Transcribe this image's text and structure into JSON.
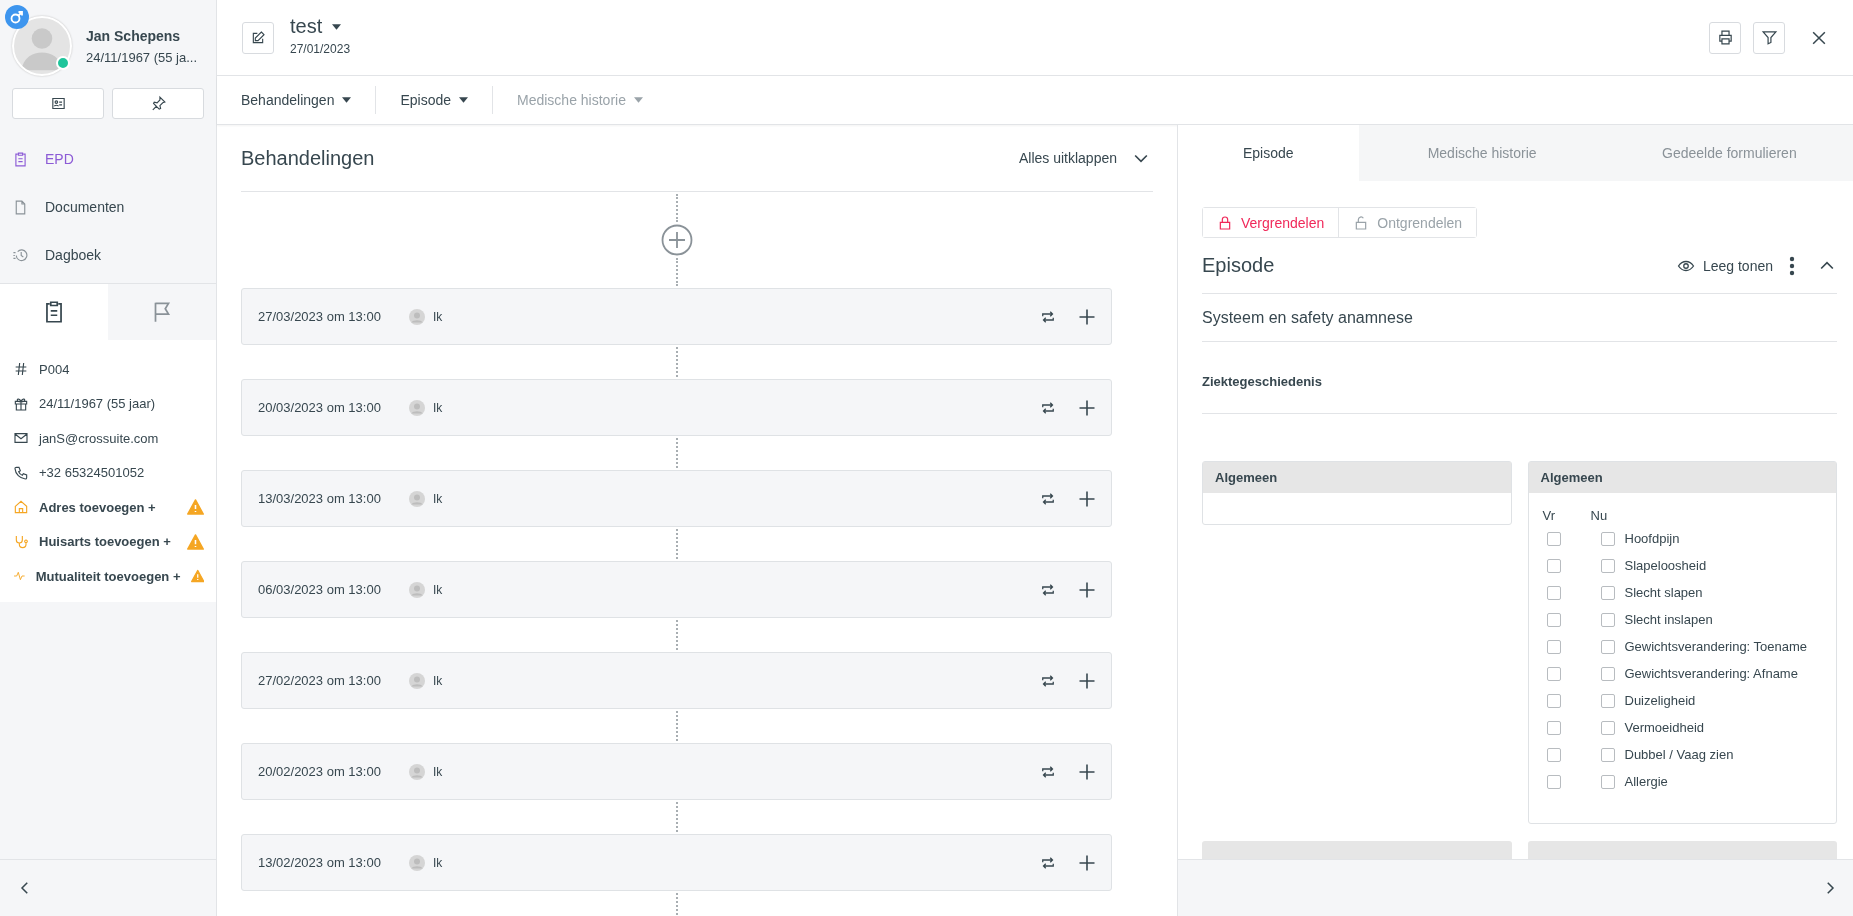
{
  "patient": {
    "name": "Jan Schepens",
    "birth": "24/11/1967 (55 ja...",
    "online": true
  },
  "sidebar_nav": [
    {
      "label": "EPD",
      "selected": true
    },
    {
      "label": "Documenten",
      "selected": false
    },
    {
      "label": "Dagboek",
      "selected": false
    }
  ],
  "sidebar_tabs": [
    {
      "selected": true
    },
    {
      "selected": false
    }
  ],
  "details": [
    {
      "kind": "info",
      "text": "P004"
    },
    {
      "kind": "info",
      "text": "24/11/1967 (55 jaar)"
    },
    {
      "kind": "info",
      "text": "janS@crossuite.com"
    },
    {
      "kind": "info",
      "text": "+32 65324501052"
    },
    {
      "kind": "warning",
      "text": "Adres toevoegen +"
    },
    {
      "kind": "warning",
      "text": "Huisarts toevoegen +"
    },
    {
      "kind": "warning",
      "text": "Mutualiteit toevoegen +"
    }
  ],
  "header": {
    "title": "test",
    "date": "27/01/2023"
  },
  "subnav": [
    {
      "label": "Behandelingen",
      "disabled": false
    },
    {
      "label": "Episode",
      "disabled": false
    },
    {
      "label": "Medische historie",
      "disabled": true
    }
  ],
  "treatments": {
    "title": "Behandelingen",
    "expand_label": "Alles uitklappen",
    "items": [
      {
        "date": "27/03/2023 om 13:00",
        "user": "Ik"
      },
      {
        "date": "20/03/2023 om 13:00",
        "user": "Ik"
      },
      {
        "date": "13/03/2023 om 13:00",
        "user": "Ik"
      },
      {
        "date": "06/03/2023 om 13:00",
        "user": "Ik"
      },
      {
        "date": "27/02/2023 om 13:00",
        "user": "Ik"
      },
      {
        "date": "20/02/2023 om 13:00",
        "user": "Ik"
      },
      {
        "date": "13/02/2023 om 13:00",
        "user": "Ik"
      }
    ]
  },
  "right": {
    "tabs": [
      {
        "label": "Episode",
        "selected": true
      },
      {
        "label": "Medische historie",
        "selected": false
      },
      {
        "label": "Gedeelde formulieren",
        "selected": false
      }
    ],
    "lock_buttons": [
      {
        "label": "Vergrendelen",
        "selected": true
      },
      {
        "label": "Ontgrendelen",
        "selected": false
      }
    ],
    "section_title": "Episode",
    "show_empty": "Leeg tonen",
    "subsection": "Systeem en safety anamnese",
    "field_label": "Ziektegeschiedenis",
    "panels": [
      {
        "title": "Algemeen"
      },
      {
        "title": "Algemeen",
        "columns": [
          "Vr",
          "Nu"
        ],
        "items": [
          {
            "label": "Hoofdpijn",
            "vr": false,
            "nu": false
          },
          {
            "label": "Slapeloosheid",
            "vr": false,
            "nu": false
          },
          {
            "label": "Slecht slapen",
            "vr": false,
            "nu": false
          },
          {
            "label": "Slecht inslapen",
            "vr": false,
            "nu": false
          },
          {
            "label": "Gewichtsverandering: Toename",
            "vr": false,
            "nu": false
          },
          {
            "label": "Gewichtsverandering: Afname",
            "vr": false,
            "nu": false
          },
          {
            "label": "Duizeligheid",
            "vr": false,
            "nu": false
          },
          {
            "label": "Vermoeidheid",
            "vr": false,
            "nu": false
          },
          {
            "label": "Dubbel / Vaag zien",
            "vr": false,
            "nu": false
          },
          {
            "label": "Allergie",
            "vr": false,
            "nu": false
          }
        ]
      }
    ]
  }
}
